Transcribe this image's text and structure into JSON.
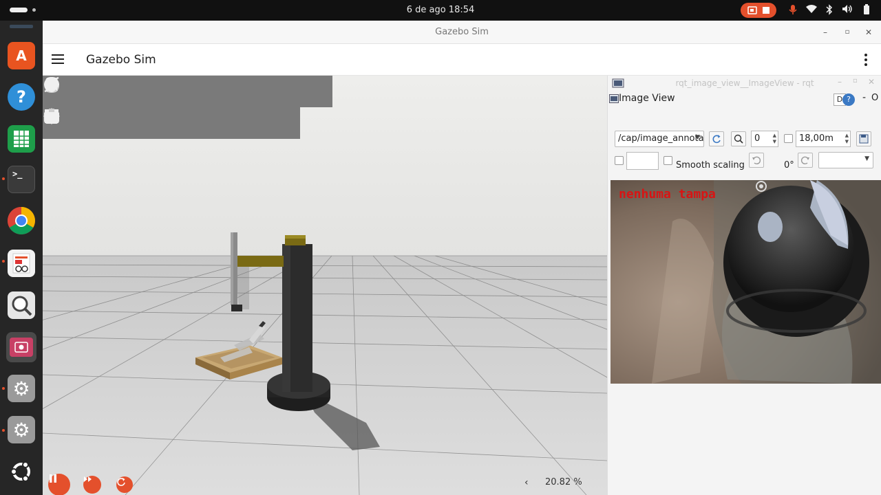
{
  "system_bar": {
    "clock": "6 de ago  18:54"
  },
  "dock": {
    "items": [
      {
        "name": "app-center",
        "glyph": "A",
        "color": "#e95420"
      },
      {
        "name": "help",
        "glyph": "?",
        "color": "#2f8fd8"
      },
      {
        "name": "spreadsheet",
        "glyph": "▦",
        "color": "#1e9e4a"
      },
      {
        "name": "terminal",
        "glyph": ">_",
        "color": "#3a3a3a"
      },
      {
        "name": "chrome",
        "glyph": "",
        "color": "#ffffff"
      },
      {
        "name": "document-viewer",
        "glyph": "▤",
        "color": "#f0f0f0"
      },
      {
        "name": "image-viewer",
        "glyph": "⌕",
        "color": "#ededed"
      },
      {
        "name": "screen-recorder",
        "glyph": "◉",
        "color": "#c84065"
      },
      {
        "name": "settings",
        "glyph": "⚙",
        "color": "#9c9c9c"
      },
      {
        "name": "settings-2",
        "glyph": "⚙",
        "color": "#9c9c9c"
      },
      {
        "name": "ubuntu",
        "glyph": "◌",
        "color": "#262626"
      }
    ]
  },
  "window": {
    "title": "Gazebo Sim"
  },
  "app": {
    "title": "Gazebo Sim"
  },
  "toolbar": {
    "shapes": [
      "box-icon",
      "sphere-icon",
      "cone-icon",
      "cylinder-icon",
      "capsule-icon",
      "ellipsoid-icon",
      "light-icon",
      "directional-light-icon",
      "spot-light-icon"
    ],
    "transforms": [
      "select-icon",
      "translate-icon",
      "rotate-icon",
      "view-angle-icon",
      "grid-icon",
      "camera-icon",
      "copy-icon",
      "paste-icon"
    ]
  },
  "sim": {
    "rtf": "20.82 %",
    "chevron": "‹"
  },
  "rqt": {
    "window_title": "rqt_image_view__ImageView - rqt",
    "plugin_label": "Image View",
    "plugin_buttons": [
      "D",
      "?",
      "-",
      "O"
    ],
    "topic": "/cap/image_annotated",
    "zoom_value": "0",
    "max_value": "18,00m",
    "smooth_scaling_label": "Smooth scaling",
    "rotation_label": "0°",
    "overlay_text": "nenhuma tampa"
  },
  "colors": {
    "accent": "#e4502c",
    "toolbar": "#7a7a7a",
    "overlay_text": "#d81414"
  }
}
